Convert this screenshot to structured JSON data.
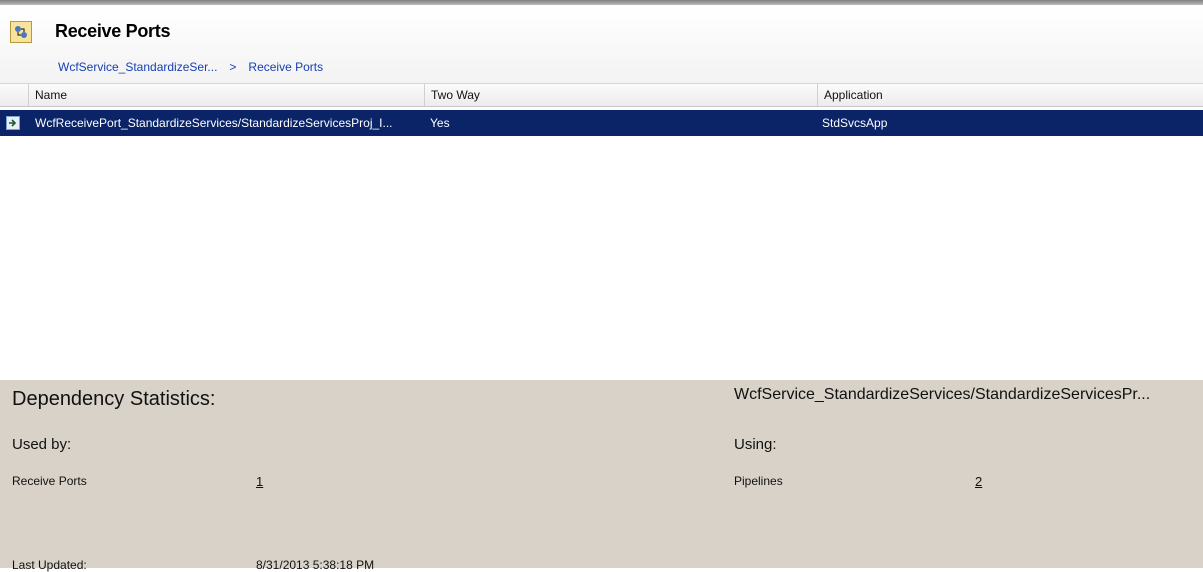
{
  "header": {
    "title": "Receive Ports",
    "breadcrumb": [
      "WcfService_StandardizeSer...",
      ">",
      "Receive Ports"
    ]
  },
  "grid": {
    "columns": [
      "Name",
      "Two Way",
      "Application"
    ],
    "rows": [
      {
        "name": "WcfReceivePort_StandardizeServices/StandardizeServicesProj_I...",
        "two_way": "Yes",
        "application": "StdSvcsApp"
      }
    ]
  },
  "details": {
    "heading": "Dependency Statistics:",
    "object_name": "WcfService_StandardizeServices/StandardizeServicesPr...",
    "used_by_label": "Used by:",
    "using_label": "Using:",
    "used_by": [
      {
        "label": "Receive Ports",
        "count": "1"
      }
    ],
    "using": [
      {
        "label": "Pipelines",
        "count": "2"
      }
    ],
    "last_updated_label": "Last Updated:",
    "last_updated_value": "8/31/2013 5:38:18 PM"
  },
  "colors": {
    "selected_row": "#0a2467",
    "details_bg": "#d8d2c8",
    "link": "#1740b0"
  },
  "icons": {
    "title": "receive-ports-icon",
    "row": "receive-port-row-icon"
  }
}
